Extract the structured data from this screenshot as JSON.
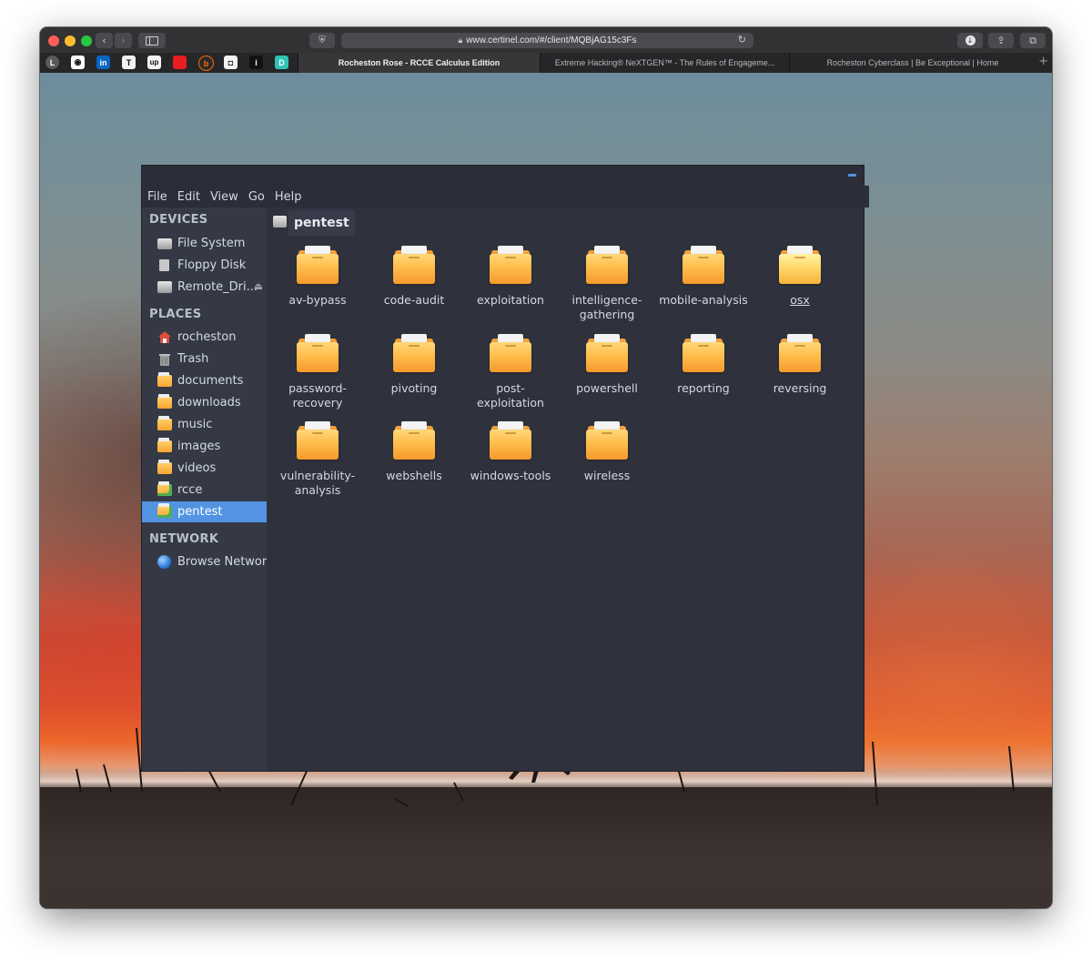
{
  "browser": {
    "url": "www.certinel.com/#/client/MQBjAG15c3Fs",
    "favicons": [
      "L",
      "in",
      "T",
      "up",
      "",
      "b",
      "",
      "i",
      "D"
    ],
    "tabs": [
      {
        "label": "Rocheston Rose - RCCE Calculus Edition",
        "active": true
      },
      {
        "label": "Extreme Hacking® NeXTGEN™ - The Rules of Engageme...",
        "active": false
      },
      {
        "label": "Rocheston Cyberclass | Be Exceptional | Home",
        "active": false
      }
    ]
  },
  "file_manager": {
    "menu": [
      "File",
      "Edit",
      "View",
      "Go",
      "Help"
    ],
    "sidebar": {
      "devices_heading": "DEVICES",
      "devices": [
        "File System",
        "Floppy Disk",
        "Remote_Dri..."
      ],
      "places_heading": "PLACES",
      "places": [
        "rocheston",
        "Trash",
        "documents",
        "downloads",
        "music",
        "images",
        "videos",
        "rcce",
        "pentest"
      ],
      "network_heading": "NETWORK",
      "network": [
        "Browse Network"
      ],
      "selected": "pentest"
    },
    "path": "pentest",
    "folders": [
      {
        "line1": "av-bypass",
        "line2": ""
      },
      {
        "line1": "code-audit",
        "line2": ""
      },
      {
        "line1": "exploitation",
        "line2": ""
      },
      {
        "line1": "intelligence-",
        "line2": "gathering"
      },
      {
        "line1": "mobile-analysis",
        "line2": ""
      },
      {
        "line1": "osx",
        "line2": ""
      },
      {
        "line1": "password-",
        "line2": "recovery"
      },
      {
        "line1": "pivoting",
        "line2": ""
      },
      {
        "line1": "post-exploitation",
        "line2": ""
      },
      {
        "line1": "powershell",
        "line2": ""
      },
      {
        "line1": "reporting",
        "line2": ""
      },
      {
        "line1": "reversing",
        "line2": ""
      },
      {
        "line1": "vulnerability-",
        "line2": "analysis"
      },
      {
        "line1": "webshells",
        "line2": ""
      },
      {
        "line1": "windows-tools",
        "line2": ""
      },
      {
        "line1": "wireless",
        "line2": ""
      }
    ]
  },
  "colors": {
    "selection": "#5294e2",
    "window_bg": "#2f313d",
    "sidebar_bg": "#353945",
    "text": "#d3dae3"
  }
}
